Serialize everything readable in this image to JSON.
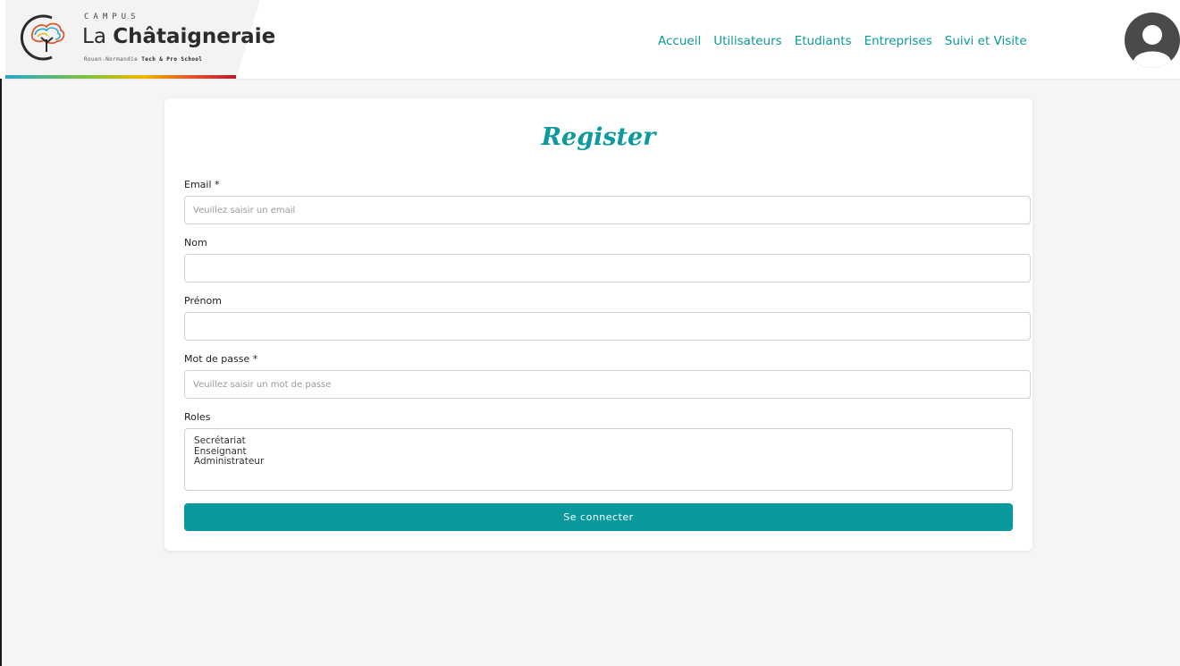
{
  "header": {
    "logo": {
      "campus": "CAMPUS",
      "name_prefix": "La",
      "name_main": "Châtaigneraie",
      "tagline_prefix": "Rouen-Normandie",
      "tagline_strong": "Tech & Pro School"
    },
    "nav": [
      {
        "label": "Accueil"
      },
      {
        "label": "Utilisateurs"
      },
      {
        "label": "Etudiants"
      },
      {
        "label": "Entreprises"
      },
      {
        "label": "Suivi et Visite"
      }
    ],
    "avatar_icon": "user-avatar-icon"
  },
  "form": {
    "title": "Register",
    "email": {
      "label": "Email *",
      "placeholder": "Veuillez saisir un email",
      "value": ""
    },
    "nom": {
      "label": "Nom",
      "value": ""
    },
    "prenom": {
      "label": "Prénom",
      "value": ""
    },
    "password": {
      "label": "Mot de passe *",
      "placeholder": "Veuillez saisir un mot de passe",
      "value": ""
    },
    "roles": {
      "label": "Roles",
      "options": [
        "Secrétariat",
        "Enseignant",
        "Administrateur"
      ]
    },
    "submit_label": "Se connecter"
  },
  "colors": {
    "accent": "#0b9a9d",
    "button": "#07999c",
    "background": "#f5f5f5"
  }
}
